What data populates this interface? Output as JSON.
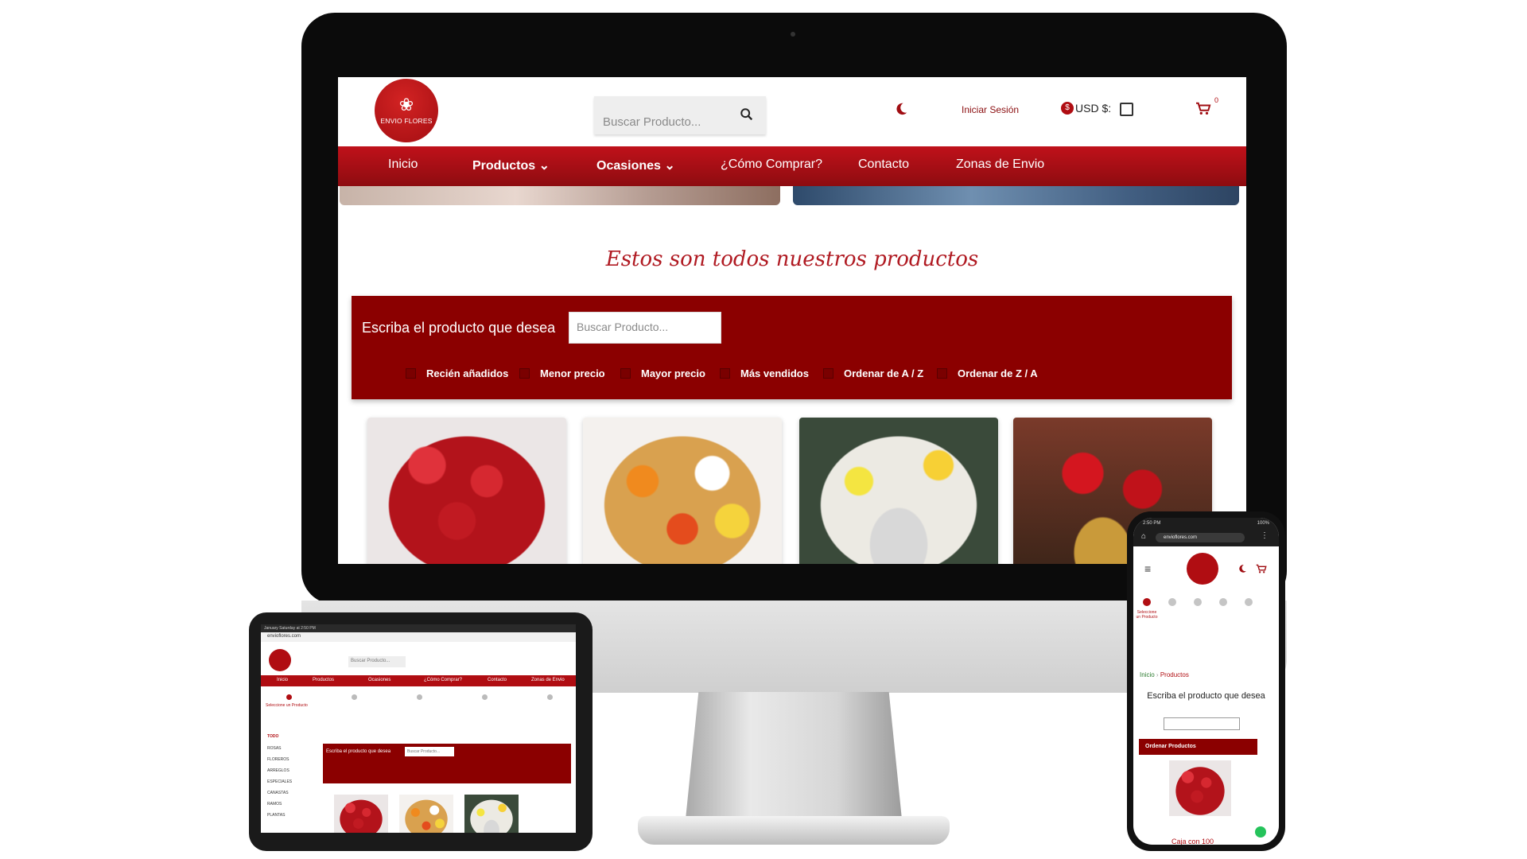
{
  "colors": {
    "brand": "#b00d12",
    "nav": "#9a0c10",
    "filter_bg": "#8b0000",
    "title": "#b01a22"
  },
  "desktop": {
    "logo_text": "ENVIO FLORES",
    "search_placeholder": "Buscar Producto...",
    "login": "Iniciar Sesión",
    "currency": "USD $:",
    "cart_count": "0",
    "nav": [
      "Inicio",
      "Productos",
      "Ocasiones",
      "¿Cómo Comprar?",
      "Contacto",
      "Zonas de Envio"
    ],
    "section_title": "Estos son todos nuestros productos",
    "filter_label": "Escriba el producto que desea",
    "filter_placeholder": "Buscar Producto...",
    "sort_options": [
      "Recién añadidos",
      "Menor precio",
      "Mayor precio",
      "Más vendidos",
      "Ordenar de A / Z",
      "Ordenar de Z / A"
    ]
  },
  "tablet": {
    "status": "January Saturday at 2:50 PM",
    "url": "envioflores.com",
    "search_placeholder": "Buscar Producto...",
    "nav": [
      "Inicio",
      "Productos",
      "Ocasiones",
      "¿Cómo Comprar?",
      "Contacto",
      "Zonas de Envio"
    ],
    "step1": "Seleccione un Producto",
    "sidebar": [
      "TODO",
      "ROSAS",
      "FLOREROS",
      "ARREGLOS",
      "ESPECIALES",
      "CANASTAS",
      "RAMOS",
      "PLANTAS"
    ],
    "filter_label": "Escriba el producto que desea",
    "filter_placeholder": "Buscar Producto..."
  },
  "phone": {
    "status_time": "2:50 PM",
    "battery": "100%",
    "url": "envioflores.com",
    "step1": "Seleccione un Producto",
    "breadcrumb_home": "Inicio",
    "breadcrumb_current": "Productos",
    "title": "Escriba el producto que desea",
    "order_label": "Ordenar Productos",
    "caption": "Caja con 100"
  }
}
